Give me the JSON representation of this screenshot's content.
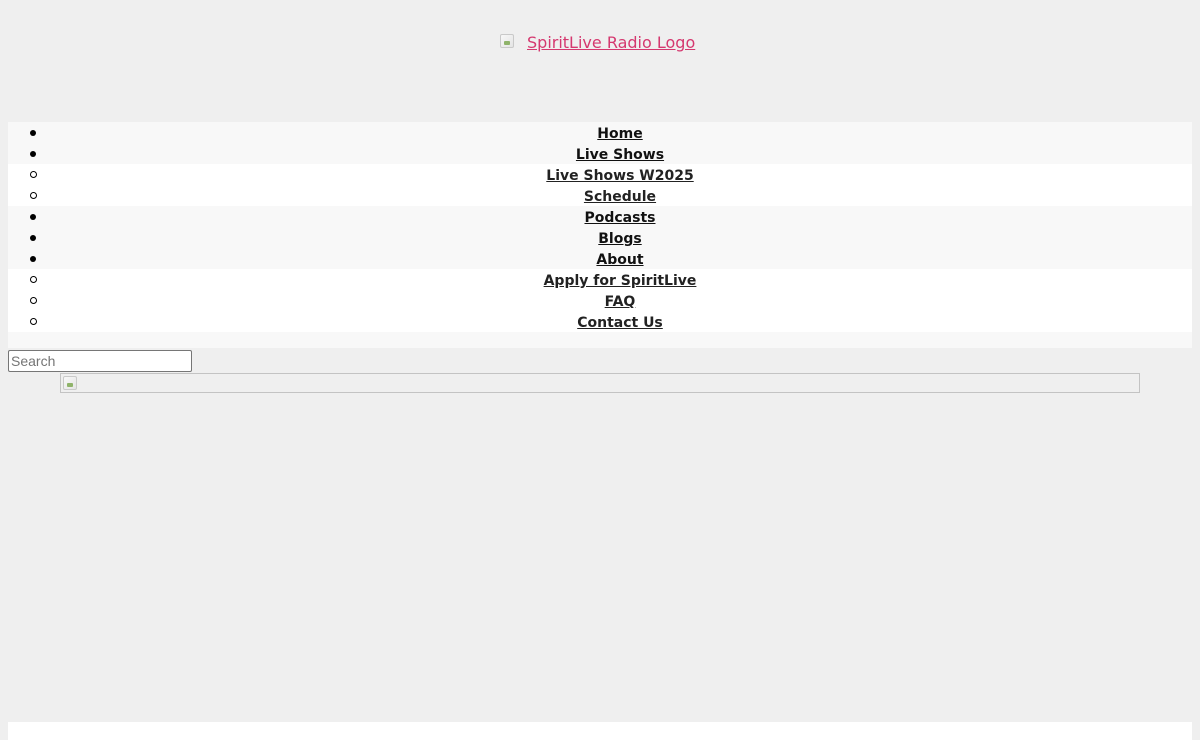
{
  "logo": {
    "alt_text": "SpiritLive Radio Logo"
  },
  "nav": {
    "items": [
      {
        "label": "Home"
      },
      {
        "label": "Live Shows",
        "children": [
          {
            "label": "Live Shows W2025"
          },
          {
            "label": "Schedule"
          }
        ]
      },
      {
        "label": "Podcasts"
      },
      {
        "label": "Blogs"
      },
      {
        "label": "About",
        "children": [
          {
            "label": "Apply for SpiritLive"
          },
          {
            "label": "FAQ"
          },
          {
            "label": "Contact Us"
          }
        ]
      }
    ]
  },
  "search": {
    "placeholder": "Search",
    "value": ""
  },
  "colors": {
    "background": "#efefef",
    "logo_link": "#d5386f",
    "nav_background": "#f8f8f8",
    "submenu_background": "#ffffff"
  },
  "icons": {
    "logo_image": "broken-image-icon",
    "banner_image": "broken-image-icon"
  }
}
